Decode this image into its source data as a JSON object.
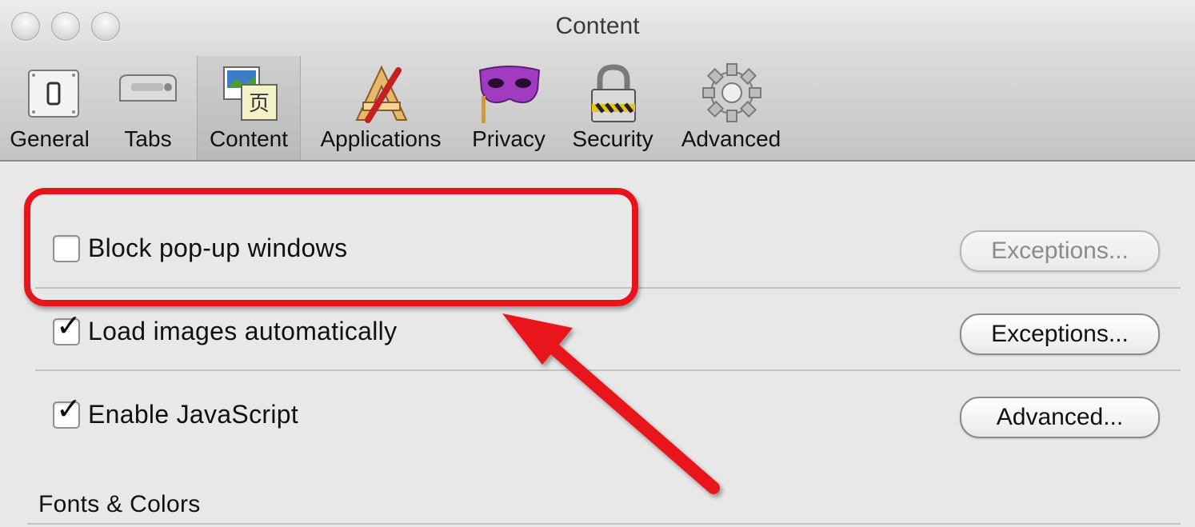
{
  "window": {
    "title": "Content"
  },
  "toolbar": {
    "items": [
      {
        "label": "General",
        "icon": "general-switch-icon"
      },
      {
        "label": "Tabs",
        "icon": "tabs-icon"
      },
      {
        "label": "Content",
        "icon": "content-icon",
        "selected": true
      },
      {
        "label": "Applications",
        "icon": "applications-icon"
      },
      {
        "label": "Privacy",
        "icon": "privacy-mask-icon"
      },
      {
        "label": "Security",
        "icon": "lock-icon"
      },
      {
        "label": "Advanced",
        "icon": "gear-icon"
      }
    ]
  },
  "content": {
    "rows": [
      {
        "label": "Block pop-up windows",
        "checked": false,
        "button": "Exceptions...",
        "button_enabled": false
      },
      {
        "label": "Load images automatically",
        "checked": true,
        "button": "Exceptions...",
        "button_enabled": true
      },
      {
        "label": "Enable JavaScript",
        "checked": true,
        "button": "Advanced...",
        "button_enabled": true
      }
    ],
    "section_header": "Fonts & Colors"
  },
  "annotation": {
    "highlight_color": "#e8141b",
    "arrow_color": "#e8141b"
  }
}
